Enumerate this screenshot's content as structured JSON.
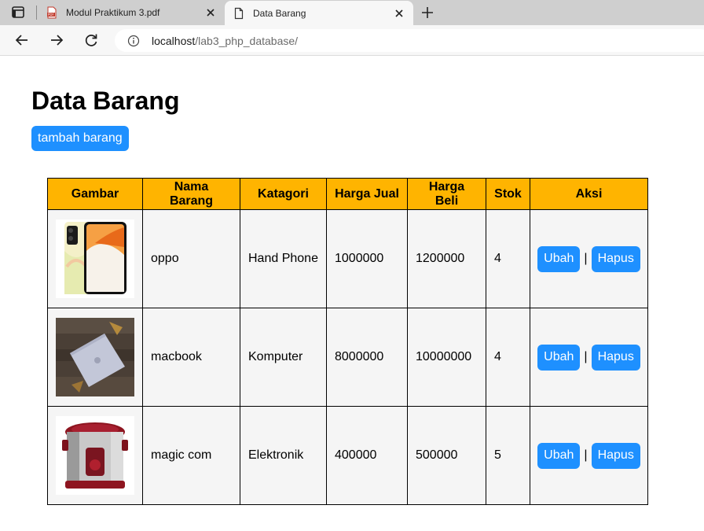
{
  "browser": {
    "tabs": [
      {
        "title": "Modul Praktikum 3.pdf",
        "icon": "pdf-icon",
        "active": false
      },
      {
        "title": "Data Barang",
        "icon": "page-icon",
        "active": true
      }
    ],
    "address": {
      "host": "localhost",
      "path": "/lab3_php_database/"
    }
  },
  "page": {
    "title": "Data Barang",
    "add_button": "tambah barang",
    "separator": "|",
    "action_labels": {
      "edit": "Ubah",
      "delete": "Hapus"
    },
    "colors": {
      "header": "#ffb400",
      "button": "#1e90ff",
      "cell": "#f5f5f5"
    },
    "table": {
      "headers": [
        "Gambar",
        "Nama Barang",
        "Katagori",
        "Harga Jual",
        "Harga Beli",
        "Stok",
        "Aksi"
      ],
      "rows": [
        {
          "image": "smartphone-image",
          "nama": "oppo",
          "kategori": "Hand Phone",
          "harga_jual": "1000000",
          "harga_beli": "1200000",
          "stok": "4"
        },
        {
          "image": "laptop-image",
          "nama": "macbook",
          "kategori": "Komputer",
          "harga_jual": "8000000",
          "harga_beli": "10000000",
          "stok": "4"
        },
        {
          "image": "rice-cooker-image",
          "nama": "magic com",
          "kategori": "Elektronik",
          "harga_jual": "400000",
          "harga_beli": "500000",
          "stok": "5"
        }
      ]
    }
  }
}
